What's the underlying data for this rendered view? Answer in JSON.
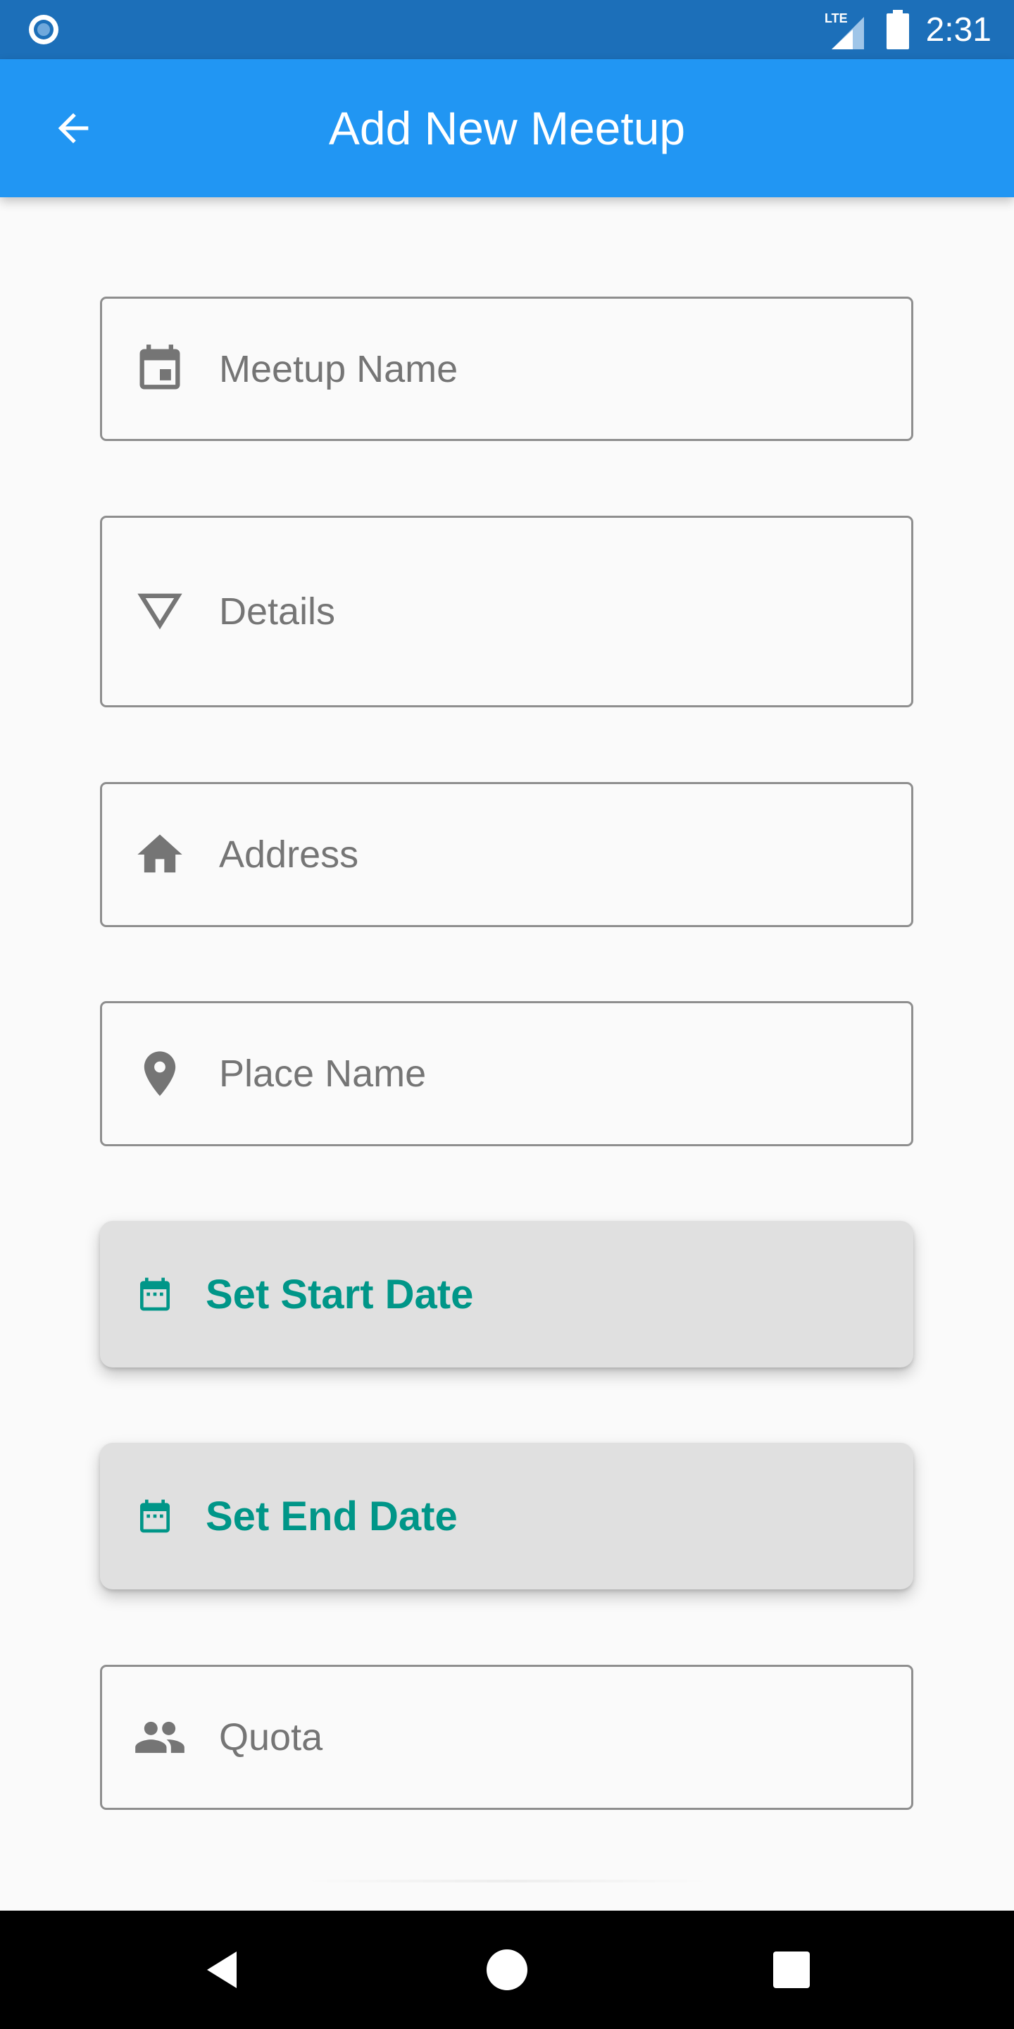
{
  "status_bar": {
    "network": "LTE",
    "time": "2:31",
    "icons": [
      "app-notification-icon",
      "lte-signal-icon",
      "battery-icon"
    ]
  },
  "app_bar": {
    "title": "Add New Meetup",
    "back_icon": "arrow-back-icon",
    "background_color": "#2196f3"
  },
  "form": {
    "meetup_name": {
      "placeholder": "Meetup Name",
      "value": "",
      "icon": "calendar-event-icon"
    },
    "details": {
      "placeholder": "Details",
      "value": "",
      "icon": "triangle-down-icon"
    },
    "address": {
      "placeholder": "Address",
      "value": "",
      "icon": "home-icon"
    },
    "place_name": {
      "placeholder": "Place Name",
      "value": "",
      "icon": "place-pin-icon"
    },
    "start_date_button": {
      "label": "Set Start Date",
      "icon": "calendar-icon"
    },
    "end_date_button": {
      "label": "Set End Date",
      "icon": "calendar-icon"
    },
    "quota": {
      "placeholder": "Quota",
      "value": "",
      "icon": "people-icon"
    },
    "accent_color": "#009688"
  },
  "nav_bar": {
    "icons": [
      "back-triangle-icon",
      "home-circle-icon",
      "recents-square-icon"
    ]
  }
}
